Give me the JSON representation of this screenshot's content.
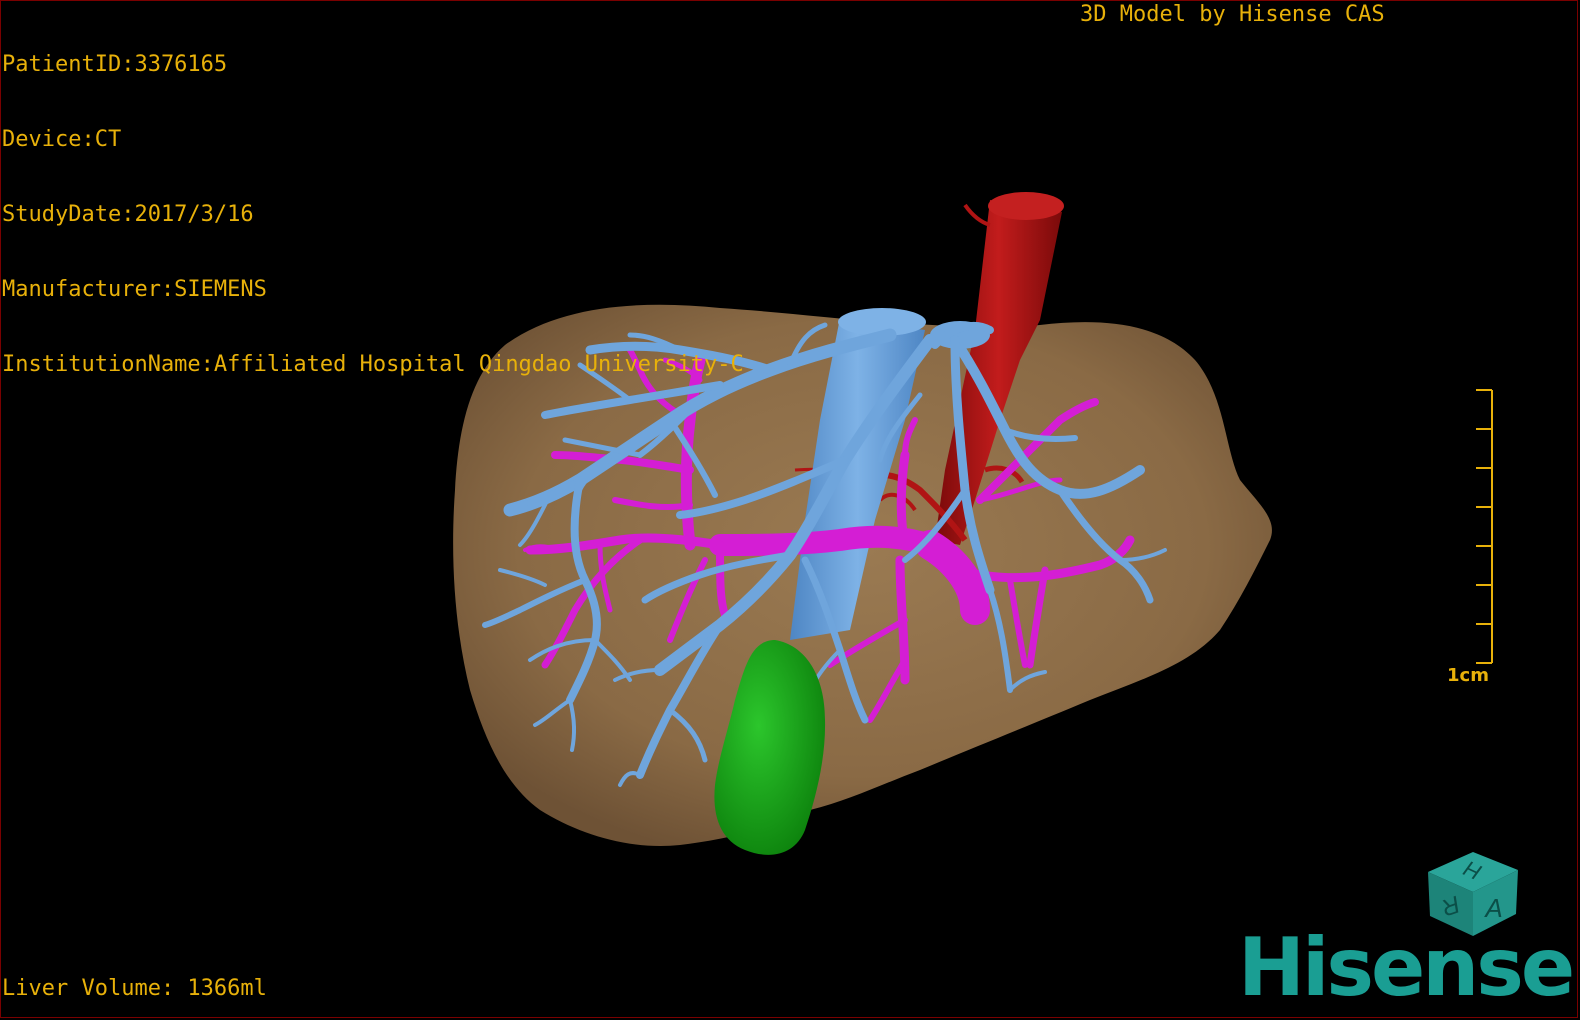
{
  "header": {
    "patient_id": "PatientID:3376165",
    "device": "Device:CT",
    "study_date": "StudyDate:2017/3/16",
    "manufacturer": "Manufacturer:SIEMENS",
    "institution": "InstitutionName:Affiliated Hospital Qingdao University-C"
  },
  "model_credit": "3D Model by Hisense CAS",
  "liver_volume": "Liver Volume: 1366ml",
  "scale_bar": {
    "label": "1cm"
  },
  "orientation_cube": {
    "faces": [
      "H",
      "R",
      "A"
    ],
    "icon": "orientation-cube-icon"
  },
  "logo": {
    "text": "Hisense",
    "color": "#1a9e93"
  },
  "colors": {
    "overlay_text": "#e8b10a",
    "liver": "#8a6a45",
    "hepatic_vein": "#6fa5dc",
    "portal_vein": "#d41ed4",
    "artery": "#b01414",
    "gallbladder": "#12a012",
    "background": "#000000"
  }
}
